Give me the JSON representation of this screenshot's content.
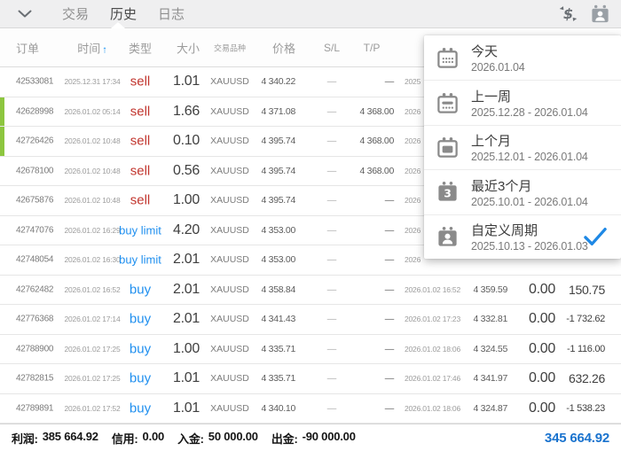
{
  "colors": {
    "sell": "#c2362f",
    "buy": "#1f8fef",
    "flag": "#8dc63f",
    "balance": "#1a73ce",
    "check": "#1e88e5",
    "sort_arrow": "#2196f3"
  },
  "topbar": {
    "tabs": [
      {
        "label": "交易",
        "active": false
      },
      {
        "label": "历史",
        "active": true
      },
      {
        "label": "日志",
        "active": false
      }
    ],
    "icons": {
      "left": "chevron-down-icon",
      "right": [
        "currency-exchange-icon",
        "custom-period-icon"
      ]
    }
  },
  "header": {
    "order": "订单",
    "time": "时间",
    "sort_arrow": "↑",
    "type": "类型",
    "size": "大小",
    "symbol": "交易品种",
    "price": "价格",
    "sl": "S/L",
    "tp": "T/P"
  },
  "table": {
    "rows": [
      {
        "order": "42533081",
        "open_time": "2025.12.31 17:34",
        "kind": "sell",
        "size": "1.01",
        "symbol": "XAUUSD",
        "price": "4 340.22",
        "sl": "—",
        "tp": "—",
        "close_time": "2025",
        "close_price": "",
        "swap": "",
        "profit": "",
        "flagged": false
      },
      {
        "order": "42628998",
        "open_time": "2026.01.02 05:14",
        "kind": "sell",
        "size": "1.66",
        "symbol": "XAUUSD",
        "price": "4 371.08",
        "sl": "—",
        "tp": "4 368.00",
        "close_time": "2026",
        "close_price": "",
        "swap": "",
        "profit": "",
        "flagged": true
      },
      {
        "order": "42726426",
        "open_time": "2026.01.02 10:48",
        "kind": "sell",
        "size": "0.10",
        "symbol": "XAUUSD",
        "price": "4 395.74",
        "sl": "—",
        "tp": "4 368.00",
        "close_time": "2026",
        "close_price": "",
        "swap": "",
        "profit": "",
        "flagged": true
      },
      {
        "order": "42678100",
        "open_time": "2026.01.02 10:48",
        "kind": "sell",
        "size": "0.56",
        "symbol": "XAUUSD",
        "price": "4 395.74",
        "sl": "—",
        "tp": "4 368.00",
        "close_time": "2026",
        "close_price": "",
        "swap": "",
        "profit": "",
        "flagged": false
      },
      {
        "order": "42675876",
        "open_time": "2026.01.02 10:48",
        "kind": "sell",
        "size": "1.00",
        "symbol": "XAUUSD",
        "price": "4 395.74",
        "sl": "—",
        "tp": "—",
        "close_time": "2026",
        "close_price": "",
        "swap": "",
        "profit": "",
        "flagged": false
      },
      {
        "order": "42747076",
        "open_time": "2026.01.02 16:29",
        "kind": "buy limit",
        "size": "4.20",
        "symbol": "XAUUSD",
        "price": "4 353.00",
        "sl": "—",
        "tp": "—",
        "close_time": "2026",
        "close_price": "",
        "swap": "",
        "profit": "",
        "flagged": false
      },
      {
        "order": "42748054",
        "open_time": "2026.01.02 16:30",
        "kind": "buy limit",
        "size": "2.01",
        "symbol": "XAUUSD",
        "price": "4 353.00",
        "sl": "—",
        "tp": "—",
        "close_time": "2026",
        "close_price": "",
        "swap": "",
        "profit": "",
        "flagged": false
      },
      {
        "order": "42762482",
        "open_time": "2026.01.02 16:52",
        "kind": "buy",
        "size": "2.01",
        "symbol": "XAUUSD",
        "price": "4 358.84",
        "sl": "—",
        "tp": "—",
        "close_time": "2026.01.02 16:52",
        "close_price": "4 359.59",
        "swap": "0.00",
        "profit": "150.75",
        "flagged": false
      },
      {
        "order": "42776368",
        "open_time": "2026.01.02 17:14",
        "kind": "buy",
        "size": "2.01",
        "symbol": "XAUUSD",
        "price": "4 341.43",
        "sl": "—",
        "tp": "—",
        "close_time": "2026.01.02 17:23",
        "close_price": "4 332.81",
        "swap": "0.00",
        "profit": "-1 732.62",
        "flagged": false
      },
      {
        "order": "42788900",
        "open_time": "2026.01.02 17:25",
        "kind": "buy",
        "size": "1.00",
        "symbol": "XAUUSD",
        "price": "4 335.71",
        "sl": "—",
        "tp": "—",
        "close_time": "2026.01.02 18:06",
        "close_price": "4 324.55",
        "swap": "0.00",
        "profit": "-1 116.00",
        "flagged": false
      },
      {
        "order": "42782815",
        "open_time": "2026.01.02 17:25",
        "kind": "buy",
        "size": "1.01",
        "symbol": "XAUUSD",
        "price": "4 335.71",
        "sl": "—",
        "tp": "—",
        "close_time": "2026.01.02 17:46",
        "close_price": "4 341.97",
        "swap": "0.00",
        "profit": "632.26",
        "flagged": false
      },
      {
        "order": "42789891",
        "open_time": "2026.01.02 17:52",
        "kind": "buy",
        "size": "1.01",
        "symbol": "XAUUSD",
        "price": "4 340.10",
        "sl": "—",
        "tp": "—",
        "close_time": "2026.01.02 18:06",
        "close_price": "4 324.87",
        "swap": "0.00",
        "profit": "-1 538.23",
        "flagged": false
      }
    ]
  },
  "period_menu": {
    "items": [
      {
        "icon": "calendar-today-icon",
        "label": "今天",
        "range": "2026.01.04",
        "selected": false
      },
      {
        "icon": "calendar-week-icon",
        "label": "上一周",
        "range": "2025.12.28 - 2026.01.04",
        "selected": false
      },
      {
        "icon": "calendar-month-icon",
        "label": "上个月",
        "range": "2025.12.01 - 2026.01.04",
        "selected": false
      },
      {
        "icon": "calendar-3months-icon",
        "label": "最近3个月",
        "range": "2025.10.01 - 2026.01.04",
        "selected": false
      },
      {
        "icon": "calendar-custom-icon",
        "label": "自定义周期",
        "range": "2025.10.13 - 2026.01.03",
        "selected": true
      }
    ]
  },
  "footer": {
    "profit_label": "利润:",
    "profit": "385 664.92",
    "credit_label": "信用:",
    "credit": "0.00",
    "deposit_label": "入金:",
    "deposit": "50 000.00",
    "withdrawal_label": "出金:",
    "withdrawal": "-90 000.00",
    "balance": "345 664.92"
  }
}
